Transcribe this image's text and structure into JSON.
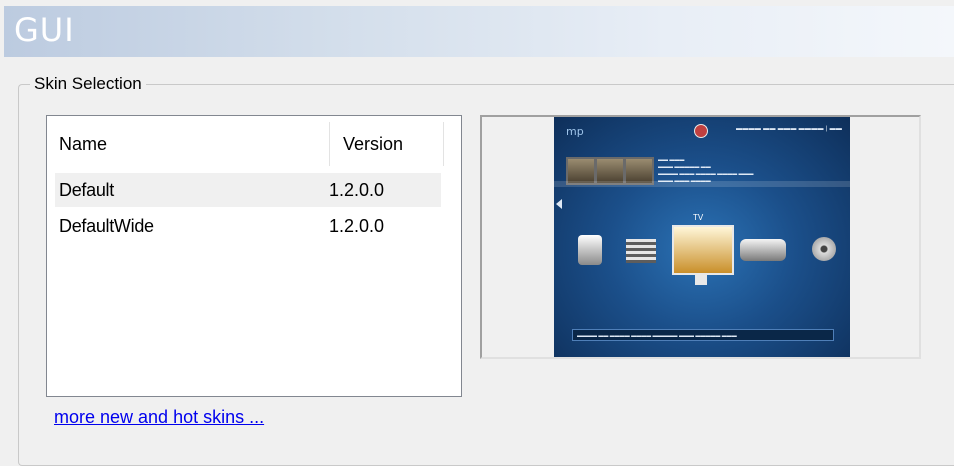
{
  "header": {
    "title": "GUI"
  },
  "skin_selection": {
    "legend": "Skin Selection",
    "columns": {
      "name": "Name",
      "version": "Version"
    },
    "skins": [
      {
        "name": "Default",
        "version": "1.2.0.0",
        "selected": true
      },
      {
        "name": "DefaultWide",
        "version": "1.2.0.0",
        "selected": false
      }
    ],
    "link": "more new and hot skins ..."
  },
  "preview": {
    "logo": "mp",
    "tv_label": "TV"
  },
  "colors": {
    "link": "#0000ee",
    "header_gradient_start": "#bccbe0",
    "preview_background": "#1b4f8a",
    "selected_row": "#f0f0f0"
  }
}
